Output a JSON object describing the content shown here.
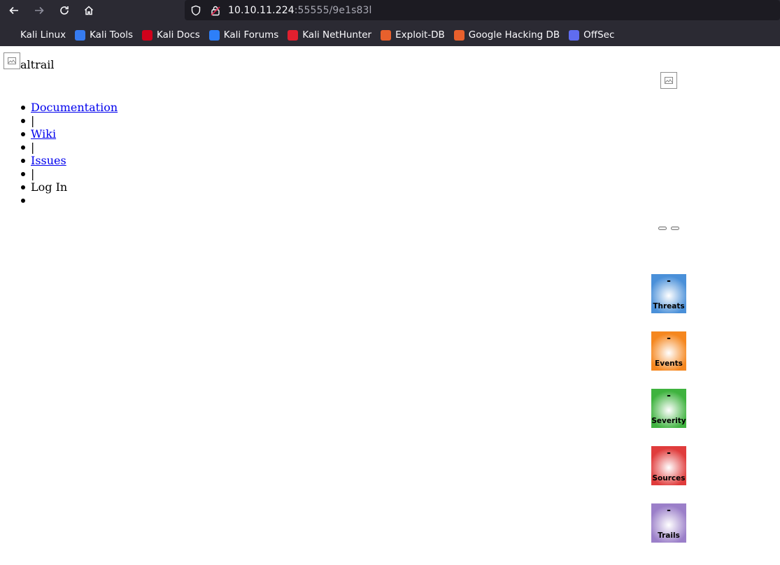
{
  "browser": {
    "url_host": "10.10.11.224",
    "url_path": ":55555/9e1s83l",
    "bookmarks": [
      {
        "label": "Kali Linux",
        "icon": "kali-dragon-icon",
        "color": "#2b2a33"
      },
      {
        "label": "Kali Tools",
        "icon": "kali-tools-icon",
        "color": "#367bf0"
      },
      {
        "label": "Kali Docs",
        "icon": "kali-docs-icon",
        "color": "#d0021b"
      },
      {
        "label": "Kali Forums",
        "icon": "kali-forums-icon",
        "color": "#2d7ff9"
      },
      {
        "label": "Kali NetHunter",
        "icon": "nethunter-icon",
        "color": "#e0202f"
      },
      {
        "label": "Exploit-DB",
        "icon": "exploit-db-icon",
        "color": "#e8602c"
      },
      {
        "label": "Google Hacking DB",
        "icon": "ghdb-icon",
        "color": "#e8602c"
      },
      {
        "label": "OffSec",
        "icon": "offsec-icon",
        "color": "#5f6cf0"
      }
    ]
  },
  "header": {
    "brand": "altrail"
  },
  "menu": {
    "items": [
      {
        "label": "Documentation",
        "link": true
      },
      {
        "label": "|",
        "link": false
      },
      {
        "label": "Wiki",
        "link": true
      },
      {
        "label": "|",
        "link": false
      },
      {
        "label": "Issues",
        "link": true
      },
      {
        "label": "|",
        "link": false
      },
      {
        "label": "Log In",
        "link": false
      },
      {
        "label": "",
        "link": false
      }
    ]
  },
  "stats": [
    {
      "label": "Threats",
      "value": "-",
      "color": "#4a90d9"
    },
    {
      "label": "Events",
      "value": "-",
      "color": "#f5871f"
    },
    {
      "label": "Severity",
      "value": "-",
      "color": "#3fb33f"
    },
    {
      "label": "Sources",
      "value": "-",
      "color": "#e03c3c"
    },
    {
      "label": "Trails",
      "value": "-",
      "color": "#9b7fc9"
    }
  ]
}
